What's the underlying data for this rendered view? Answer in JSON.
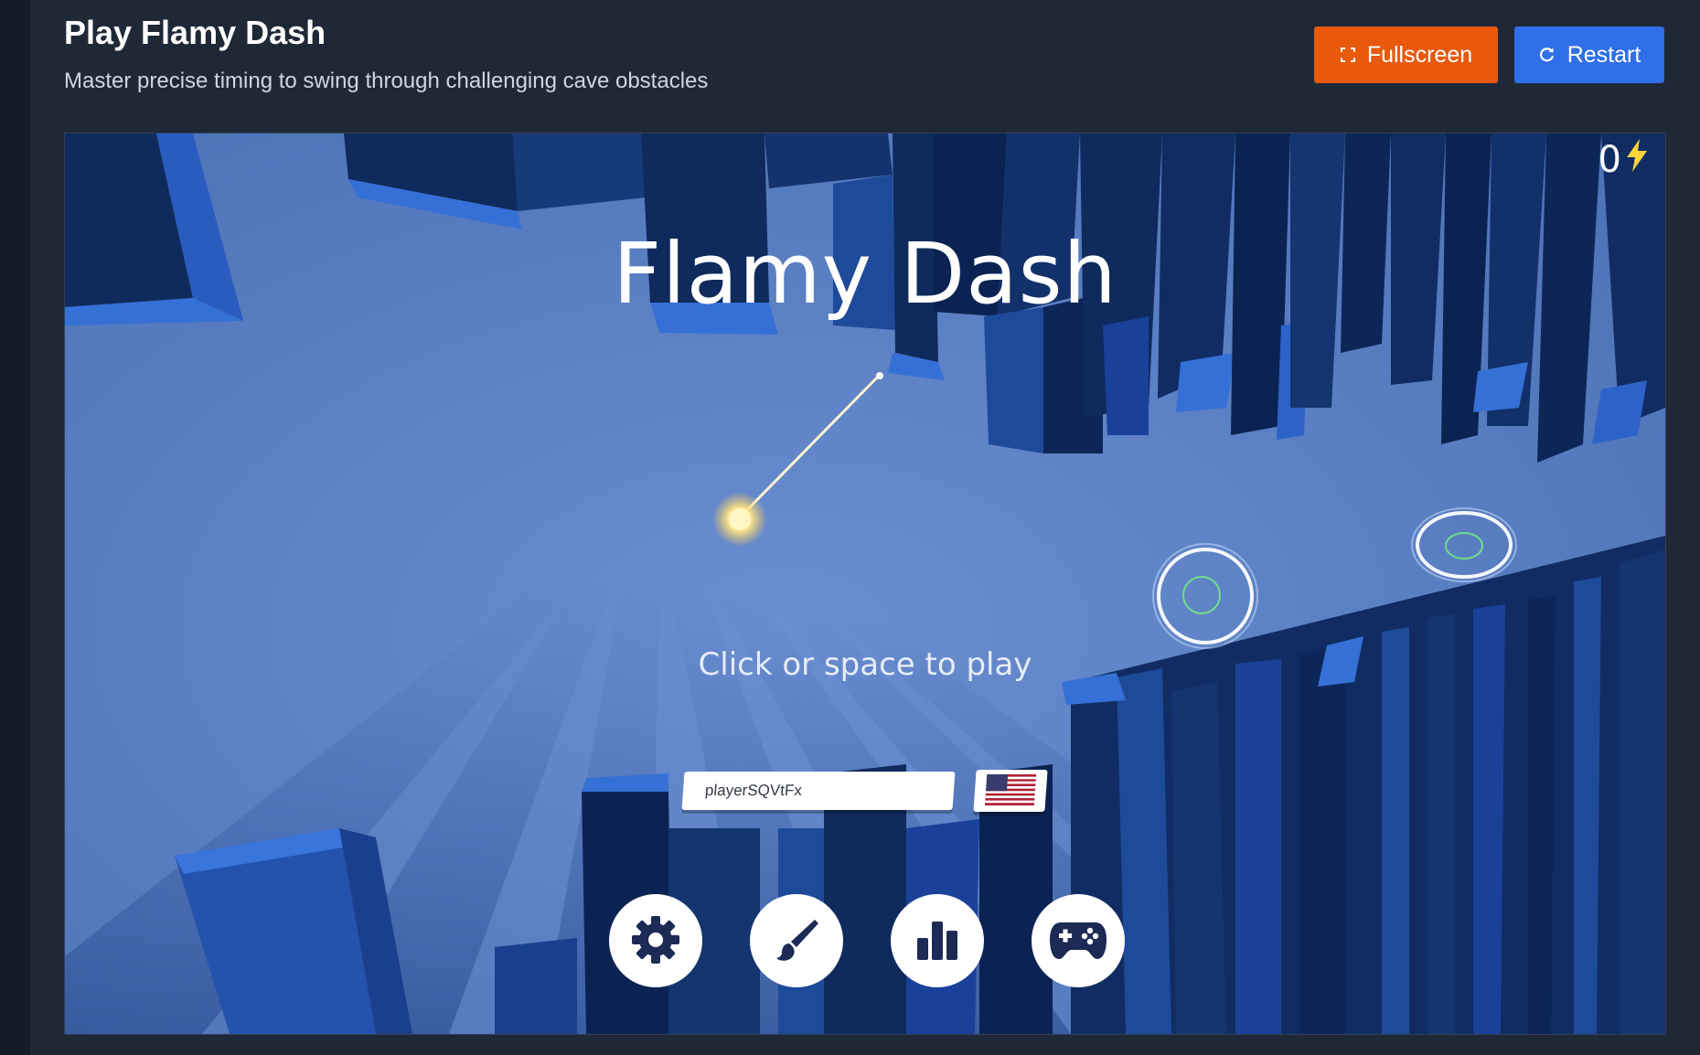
{
  "header": {
    "title": "Play Flamy Dash",
    "subtitle": "Master precise timing to swing through challenging cave obstacles"
  },
  "toolbar": {
    "fullscreen_label": "Fullscreen",
    "restart_label": "Restart",
    "fullscreen_color": "#e8590c",
    "restart_color": "#2f6fe8"
  },
  "game": {
    "score": "0",
    "title": "Flamy Dash",
    "play_hint": "Click or space to play",
    "player_name": "playerSQVtFx",
    "flag": "us-flag-icon",
    "menu_buttons": [
      "settings-icon",
      "brush-icon",
      "leaderboard-icon",
      "gamepad-icon"
    ],
    "colors": {
      "background": "#5a7fbf",
      "pillar_dark": "#0f2a5c",
      "pillar_mid": "#1e4a9a",
      "pillar_light": "#3570d6",
      "glow": "#fff3b0"
    }
  }
}
